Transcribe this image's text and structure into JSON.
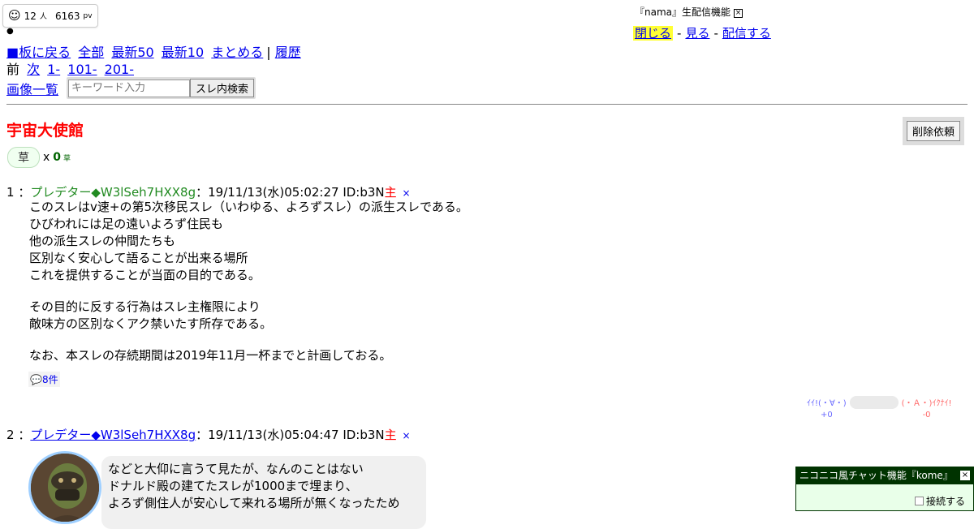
{
  "counter": {
    "online": "12",
    "online_unit": "人",
    "pv": "6163",
    "pv_unit": "pv"
  },
  "nav": {
    "links": [
      "■板に戻る",
      "全部",
      "最新50",
      "最新10",
      "まとめる"
    ],
    "history": "履歴",
    "separator": "|",
    "prev": "前",
    "next": "次",
    "pages": [
      "1-",
      "101-",
      "201-"
    ],
    "images": "画像一覧"
  },
  "search": {
    "placeholder": "キーワード入力",
    "button": "スレ内検索"
  },
  "nama": {
    "label": "『nama』生配信機能",
    "close": "閉じる",
    "view": "見る",
    "broadcast": "配信する",
    "sep": "-"
  },
  "thread": {
    "title": "宇宙大使館",
    "delete_button": "削除依頼"
  },
  "kusa": {
    "label": "草",
    "times": "x",
    "count": "0",
    "unit": "草"
  },
  "posts": [
    {
      "num": "1",
      "sep": "：",
      "name": "プレデター◆W3lSeh7HXX8g",
      "date": "：19/11/13(水)05:02:27 ID:b3N",
      "nushi": "主",
      "x": "×",
      "body": [
        "このスレはv速+の第5次移民スレ（いわゆる、よろずスレ）の派生スレである。",
        "ひびわれには足の遠いよろず住民も",
        "他の派生スレの仲間たちも",
        "区別なく安心して語ることが出来る場所",
        "これを提供することが当面の目的である。",
        "その目的に反する行為はスレ主権限により",
        "敵味方の区別なくアク禁いたす所存である。",
        "なお、本スレの存続期間は2019年11月一杯までと計画しておる。"
      ],
      "comments": "8件"
    },
    {
      "num": "2",
      "sep": "：",
      "name": "プレデター◆W3lSeh7HXX8g",
      "date": "：19/11/13(水)05:04:47 ID:b3N",
      "nushi": "主",
      "x": "×",
      "body": [
        "などと大仰に言うて見たが、なんのことはない",
        "ドナルド殿の建てたスレが1000まで埋まり、",
        "よろず側住人が安心して来れる場所が無くなったため"
      ]
    }
  ],
  "votes": {
    "good": "ｲｲ!(・∀・)",
    "good_count": "+0",
    "bad": "(・Ａ・)ｲｸﾅｲ!",
    "bad_count": "-0"
  },
  "kome": {
    "title": "ニコニコ風チャット機能『kome』",
    "close": "×",
    "connect": "接続する"
  }
}
